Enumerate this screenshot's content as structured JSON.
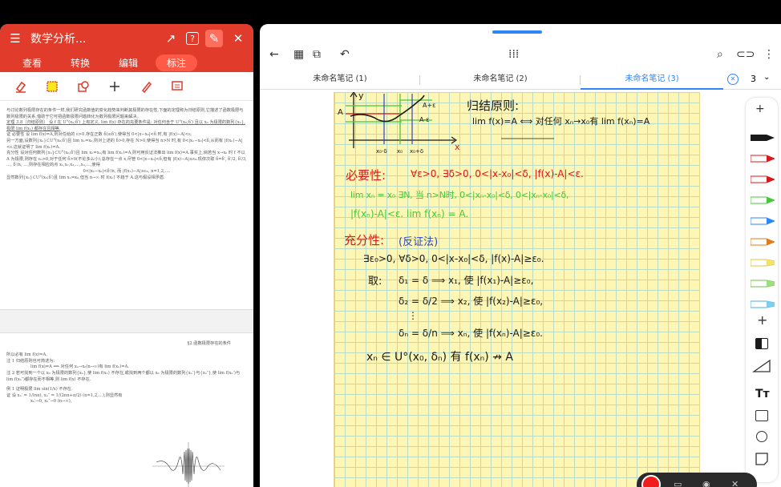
{
  "left_app": {
    "title": "数学分析...",
    "tabs": [
      "查看",
      "转换",
      "编辑",
      "标注"
    ],
    "active_tab": "标注",
    "header_color": "#e13b2b",
    "tools": [
      "eraser-icon",
      "highlight-box-icon",
      "shape-icon",
      "plus-icon",
      "pen-icon",
      "comment-icon"
    ],
    "doc_page1": [
      "与讨论数列极限存在的条件一样,我们研究函数值的变化趋势来判断其极限的存在性,下面的定理称为归结原则,它描述了函数极限与数列极限的关系,借助于它可把函数极限问题转化为数列极限问题来解决。",
      "定理 3.8（归结原则） 设 f 在 U°(x₀;δ′) 上有定义. lim f(x) 存在的充要条件是: 对任何含于 U°(x₀;δ′) 且以 x₀ 为极限的数列{xₙ},极限 lim f(xₙ) 都存在且相等.",
      "证 必要性 设 lim f(x)=A,则对任给的 ε>0,存在正数 δ(≤δ′),使得当 0<|x−x₀|<δ 时,有 |f(x)−A|<ε.",
      "另一方面,设数列{xₙ}⊂U°(x₀;δ′)且 lim xₙ=x₀,则对上述的 δ>0,存在 N>0,使得当 n>N 时,有 0<|xₙ−x₀|<δ,从而有 |f(xₙ)−A|<ε.这就证明了 lim f(xₙ)=A.",
      "充分性 设对任何数列{xₙ}⊂U°(x₀;δ′)且 lim xₙ=x₀,有 lim f(xₙ)=A,则可用反证法推出 lim f(x)=A.事实上,倘若当 x→x₀ 时 f 不以 A 为极限,则存在 ε₀>0,对于任何 δ>0(不论多么小),总存在一点 x,尽管 0<|x−x₀|<δ,但有 |f(x)−A|≥ε₀.现依次取 δ=δ′, δ′/2, δ′/3, …, δ′/n, …,则存在相应的点 x₁,x₂,x₃,…,xₙ,…,使得",
      "0<|xₙ−x₀|<δ′/n, 而 |f(xₙ)−A|≥ε₀, n=1,2,….",
      "显然数列{xₙ}⊂U°(x₀;δ′)且 lim xₙ=x₀,但当 n→∞ 时 f(xₙ) 不趋于 A.这与假设相矛盾."
    ],
    "page_header2": "§2  函数极限存在的条件",
    "doc_page2": [
      "所以必有 lim f(x)=A.",
      "注 1  归结原则也可简述为:",
      "lim f(x)=A ⟺ 对任何 xₙ→x₀(n→∞)有 lim f(xₙ)=A.",
      "注 2  若可找到一个以 x₀ 为极限的数列{xₙ},使 lim f(xₙ) 不存在,或找到两个都以 x₀ 为极限的数列{xₙ′}与{xₙ″},使 lim f(xₙ′)与 lim f(xₙ″)都存在而不相等,则 lim f(x) 不存在.",
      "例 1  证明极限 lim sin(1/x) 不存在.",
      "证  设 xₙ′ = 1/(nπ), xₙ″ = 1/(2nπ+π/2) (n=1,2,…),则显然有",
      "xₙ′→0, xₙ″→0 (n→∞),"
    ]
  },
  "right_app": {
    "tabs": [
      "未命名笔记 (1)",
      "未命名笔记 (2)",
      "未命名笔记 (3)"
    ],
    "active_tab_index": 2,
    "page_count": "3",
    "accent": "#2f86f6",
    "paper_color": "#fdf6b4",
    "notes": {
      "graph_labels": [
        "y",
        "x",
        "A",
        "A+ε",
        "A-ε",
        "x₀-δ",
        "x₀",
        "x₀+δ"
      ],
      "title": "归结原则:",
      "principle": "lim f(x)=A ⟺ 对任何 xₙ→x₀有 lim f(xₙ)=A",
      "necessity_head": "必要性:",
      "necessity_line": "∀ε>0, ∃δ>0, 0<|x-x₀|<δ, |f(x)-A|<ε.",
      "green_line1": "lim xₙ = x₀     ∃N, 当 n>N时, 0<|xₙ-x₀|<δ, 0<|xₙ-x₀|<δ,",
      "green_line2": "|f(xₙ)-A|<ε.     lim f(xₙ) = A.",
      "sufficiency_head": "充分性:",
      "sufficiency_note": "(反证法)",
      "line_s1": "∃ε₀>0, ∀δ>0, 0<|x-x₀|<δ,   |f(x)-A|≥ε₀.",
      "line_s2_take": "取:",
      "line_s2": "δ₁ = δ   ⟹   x₁, 使 |f(x₁)-A|≥ε₀,",
      "line_s3": "δ₂ = δ/2   ⟹   x₂, 使 |f(x₂)-A|≥ε₀,",
      "line_s4": "⋮",
      "line_s5": "δₙ = δ/n   ⟹   xₙ, 使 |f(xₙ)-A|≥ε₀.",
      "line_s6": "xₙ ∈ U°(x₀, δₙ)  有  f(xₙ) ↛ A"
    },
    "pen_colors": [
      "#1a1a1a",
      "#d8191c",
      "#d8191c",
      "#47c83a",
      "#2f86f6",
      "#e27b1c",
      "#f1e26a",
      "#9be07a",
      "#7fd0f0"
    ]
  }
}
